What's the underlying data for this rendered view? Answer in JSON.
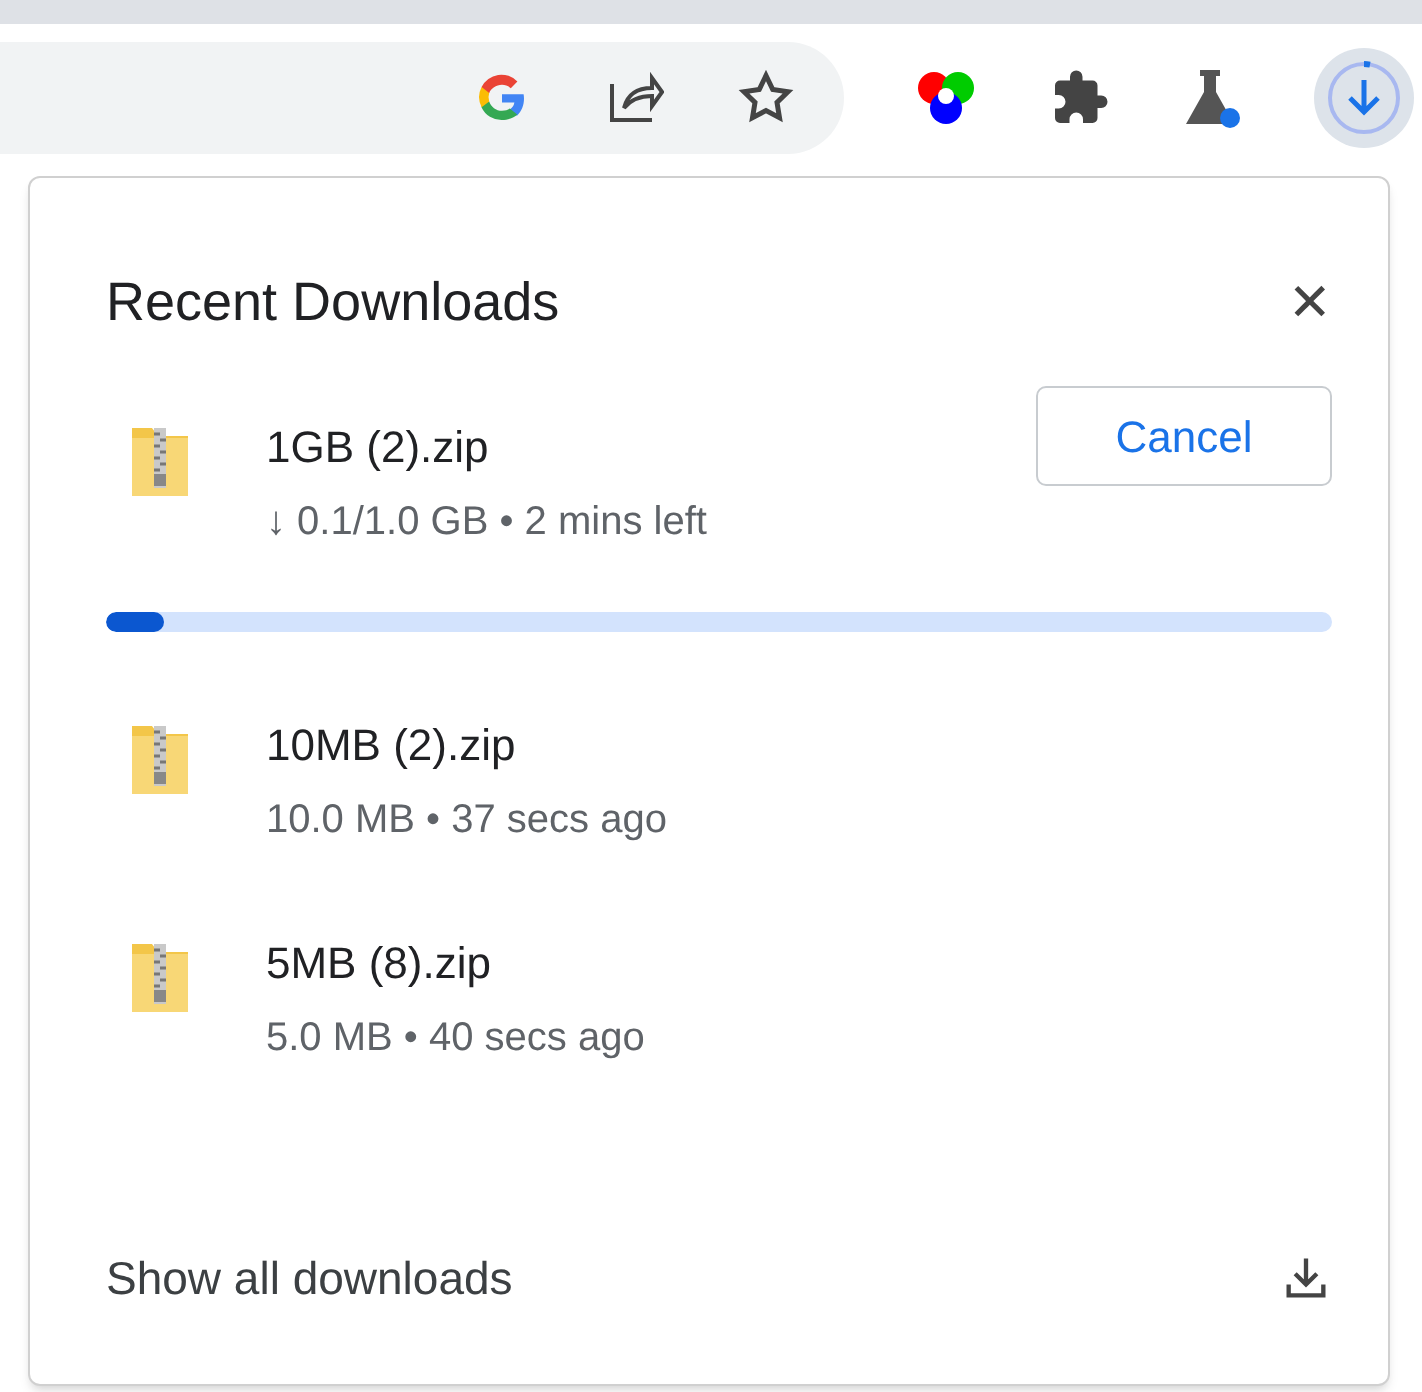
{
  "toolbar": {
    "download_in_progress": true
  },
  "panel": {
    "title": "Recent Downloads",
    "close": "✕"
  },
  "downloads": [
    {
      "kind": "active",
      "name": "1GB (2).zip",
      "status": "↓ 0.1/1.0 GB • 2 mins left",
      "button": "Cancel",
      "level": 0.048
    },
    {
      "kind": "done",
      "name": "10MB (2).zip",
      "status": "10.0 MB • 37 secs ago"
    },
    {
      "kind": "done",
      "name": "5MB (8).zip",
      "status": "5.0 MB • 40 secs ago"
    }
  ],
  "footer": {
    "label": "Show all downloads"
  }
}
